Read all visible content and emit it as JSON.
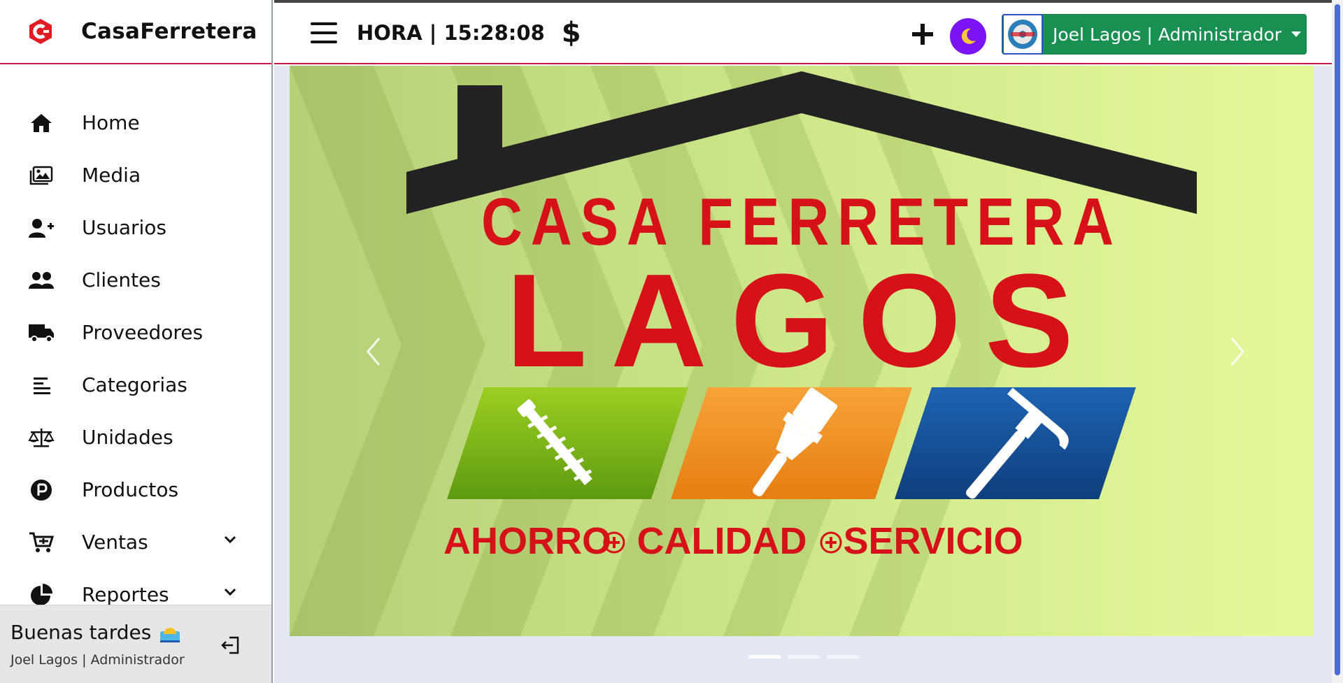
{
  "brand": {
    "name": "CasaFerretera",
    "accent": "#c8174a"
  },
  "sidebar": {
    "items": [
      {
        "label": "Home",
        "icon": "home-icon"
      },
      {
        "label": "Media",
        "icon": "media-icon"
      },
      {
        "label": "Usuarios",
        "icon": "user-plus-icon"
      },
      {
        "label": "Clientes",
        "icon": "users-icon"
      },
      {
        "label": "Proveedores",
        "icon": "truck-icon"
      },
      {
        "label": "Categorias",
        "icon": "align-left-icon"
      },
      {
        "label": "Unidades",
        "icon": "scale-icon"
      },
      {
        "label": "Productos",
        "icon": "product-p-icon"
      },
      {
        "label": "Ventas",
        "icon": "cart-icon",
        "expandable": true
      },
      {
        "label": "Reportes",
        "icon": "pie-chart-icon",
        "expandable": true
      }
    ],
    "greeting": {
      "title": "Buenas tardes",
      "subtitle": "Joel Lagos | Administrador"
    }
  },
  "topbar": {
    "clock": "HORA | 15:28:08",
    "currency_symbol": "$",
    "user_label": "Joel Lagos | Administrador",
    "user_button_color": "#1a8f52",
    "theme_button_color": "#7b14f5"
  },
  "banner": {
    "line1": "CASA FERRETERA",
    "line2": "LAGOS",
    "slogan": [
      "AHORRO",
      "CALIDAD",
      "SERVICIO"
    ],
    "colors": {
      "text_red": "#d6111a",
      "roof": "#222222",
      "tile_green": "#7bb71b",
      "tile_orange": "#f0921e",
      "tile_blue": "#17509a",
      "background": "#d4ee8a"
    }
  },
  "carousel": {
    "slides": 3,
    "active_index": 0
  }
}
